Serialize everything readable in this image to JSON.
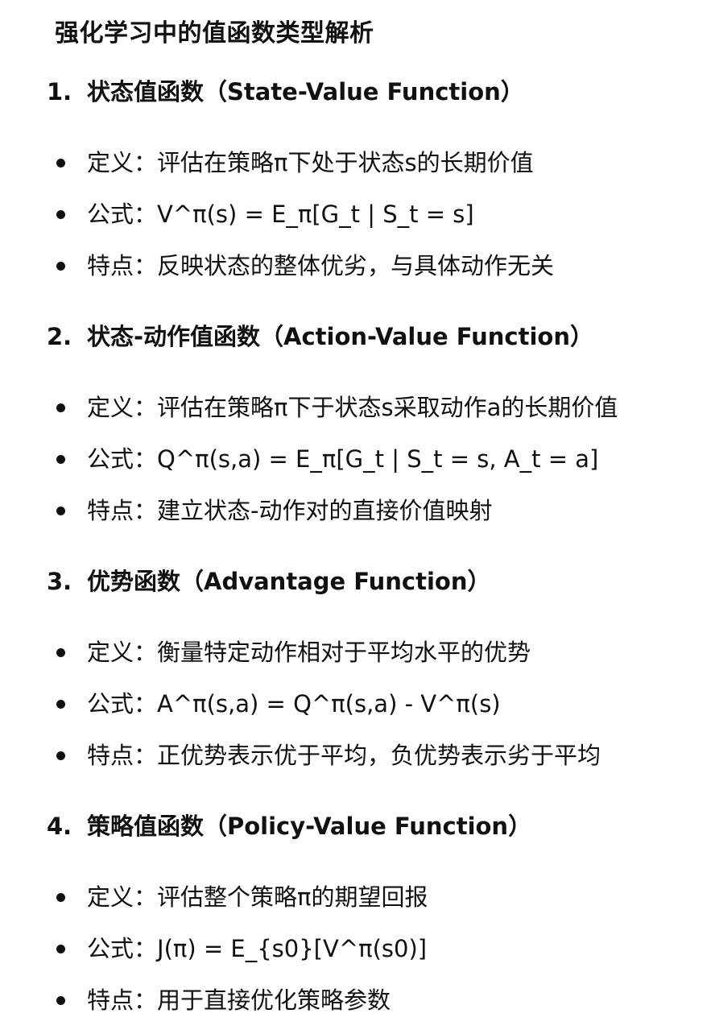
{
  "title": "强化学习中的值函数类型解析",
  "sections": [
    {
      "number": "1.",
      "heading": "状态值函数（State-Value Function）",
      "items": [
        {
          "label": "定义：",
          "value": "评估在策略π下处于状态s的长期价值"
        },
        {
          "label": "公式：",
          "value": "V^π(s) = E_π[G_t | S_t = s]"
        },
        {
          "label": "特点：",
          "value": "反映状态的整体优劣，与具体动作无关"
        }
      ]
    },
    {
      "number": "2.",
      "heading": "状态-动作值函数（Action-Value Function）",
      "items": [
        {
          "label": "定义：",
          "value": "评估在策略π下于状态s采取动作a的长期价值"
        },
        {
          "label": "公式：",
          "value": "Q^π(s,a) = E_π[G_t | S_t = s, A_t = a]"
        },
        {
          "label": "特点：",
          "value": "建立状态-动作对的直接价值映射"
        }
      ]
    },
    {
      "number": "3.",
      "heading": "优势函数（Advantage Function）",
      "items": [
        {
          "label": "定义：",
          "value": "衡量特定动作相对于平均水平的优势"
        },
        {
          "label": "公式：",
          "value": "A^π(s,a) = Q^π(s,a) - V^π(s)"
        },
        {
          "label": "特点：",
          "value": "正优势表示优于平均，负优势表示劣于平均"
        }
      ]
    },
    {
      "number": "4.",
      "heading": "策略值函数（Policy-Value Function）",
      "items": [
        {
          "label": "定义：",
          "value": "评估整个策略π的期望回报"
        },
        {
          "label": "公式：",
          "value": "J(π) = E_{s0}[V^π(s0)]"
        },
        {
          "label": "特点：",
          "value": "用于直接优化策略参数"
        }
      ]
    }
  ]
}
